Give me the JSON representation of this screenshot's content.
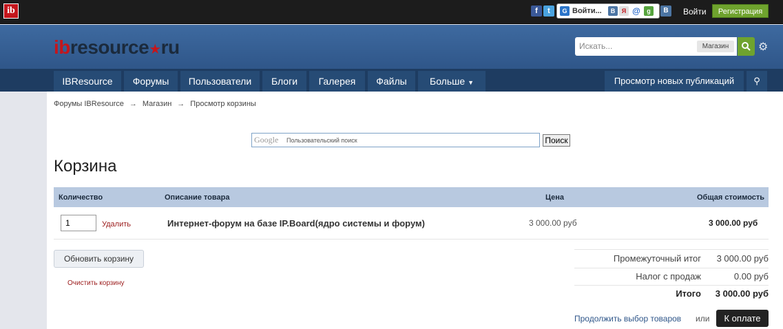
{
  "topbar": {
    "logo": "ib",
    "login_with": "Войти...",
    "sign_in": "Войти",
    "register": "Регистрация"
  },
  "header": {
    "brand_ib": "ib",
    "brand_resource": "resource",
    "brand_ru": "ru",
    "search_placeholder": "Искать...",
    "search_scope": "Магазин"
  },
  "nav": {
    "items": [
      "IBResource",
      "Форумы",
      "Пользователи",
      "Блоги",
      "Галерея",
      "Файлы",
      "Больше"
    ],
    "view_new": "Просмотр новых публикаций"
  },
  "breadcrumb": [
    "Форумы IBResource",
    "Магазин",
    "Просмотр корзины"
  ],
  "google_search": {
    "logo": "Google",
    "placeholder": "Пользовательский поиск",
    "button": "Поиск"
  },
  "page_title": "Корзина",
  "table": {
    "headers": [
      "Количество",
      "Описание товара",
      "Цена",
      "Общая стоимость"
    ],
    "rows": [
      {
        "qty": "1",
        "remove": "Удалить",
        "name": "Интернет-форум на базе IP.Board(ядро системы и форум)",
        "price": "3 000.00 руб",
        "total": "3 000.00 руб"
      }
    ]
  },
  "actions": {
    "update": "Обновить корзину",
    "clear": "Очистить корзину"
  },
  "summary": {
    "subtotal_label": "Промежуточный итог",
    "subtotal": "3 000.00 руб",
    "tax_label": "Налог с продаж",
    "tax": "0.00 руб",
    "total_label": "Итого",
    "total": "3 000.00 руб"
  },
  "footer": {
    "continue": "Продолжить выбор товаров",
    "or": "или",
    "checkout": "К оплате"
  }
}
